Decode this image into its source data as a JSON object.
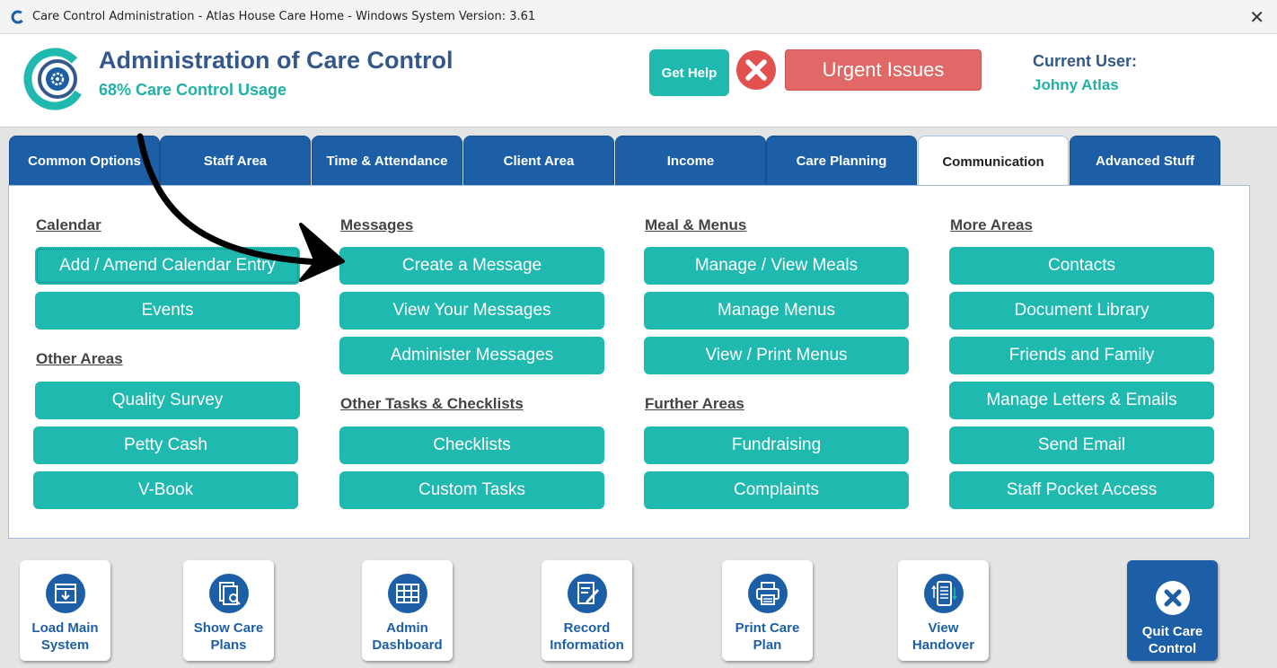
{
  "window": {
    "title": "Care Control Administration - Atlas House Care Home - Windows System Version: 3.61",
    "close_glyph": "✕"
  },
  "header": {
    "title": "Administration of Care Control",
    "usage": "68% Care Control Usage",
    "get_help": "Get Help",
    "urgent_issues": "Urgent Issues",
    "current_user_label": "Current User:",
    "current_user": "Johny Atlas"
  },
  "tabs": [
    {
      "label": "Common Options"
    },
    {
      "label": "Staff Area"
    },
    {
      "label": "Time & Attendance"
    },
    {
      "label": "Client Area"
    },
    {
      "label": "Income"
    },
    {
      "label": "Care Planning"
    },
    {
      "label": "Communication",
      "active": true
    },
    {
      "label": "Advanced Stuff"
    }
  ],
  "sections": {
    "calendar": {
      "title": "Calendar",
      "buttons": [
        "Add / Amend Calendar Entry",
        "Events"
      ]
    },
    "other_areas": {
      "title": "Other Areas",
      "buttons": [
        "Quality Survey",
        "Petty Cash",
        "V-Book"
      ]
    },
    "messages": {
      "title": "Messages",
      "buttons": [
        "Create a Message",
        "View Your Messages",
        "Administer Messages"
      ]
    },
    "other_tasks": {
      "title": "Other Tasks & Checklists",
      "buttons": [
        "Checklists",
        "Custom Tasks"
      ]
    },
    "meal_menus": {
      "title": "Meal & Menus",
      "buttons": [
        "Manage / View Meals",
        "Manage Menus",
        "View / Print Menus"
      ]
    },
    "further_areas": {
      "title": "Further Areas",
      "buttons": [
        "Fundraising",
        "Complaints"
      ]
    },
    "more_areas": {
      "title": "More Areas",
      "buttons": [
        "Contacts",
        "Document Library",
        "Friends and Family",
        "Manage Letters & Emails",
        "Send Email",
        "Staff Pocket Access"
      ]
    }
  },
  "toolbar": [
    {
      "label": "Load Main System",
      "icon": "load-icon"
    },
    {
      "label": "Show Care Plans",
      "icon": "care-plans-icon"
    },
    {
      "label": "Admin Dashboard",
      "icon": "dashboard-icon"
    },
    {
      "label": "Record Information",
      "icon": "record-icon"
    },
    {
      "label": "Print Care Plan",
      "icon": "printer-icon"
    },
    {
      "label": "View Handover",
      "icon": "handover-icon"
    }
  ],
  "quit": {
    "label": "Quit Care Control",
    "icon": "close-circle-icon"
  },
  "colors": {
    "accent": "#20b9b0",
    "brand_blue": "#1d5fa7",
    "title_blue": "#34588a",
    "urgent_red": "#e06866"
  }
}
